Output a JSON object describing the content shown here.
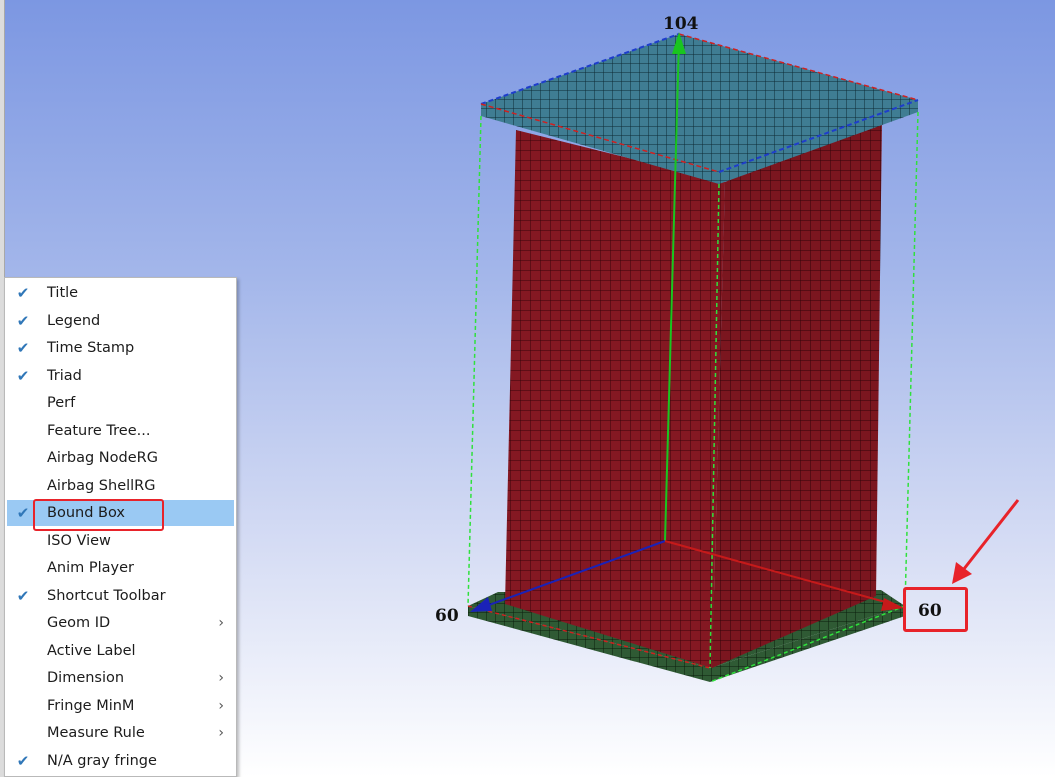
{
  "viewport": {
    "dimension_top": "104",
    "dimension_left": "60",
    "dimension_right": "60"
  },
  "menu": {
    "items": [
      {
        "label": "Title",
        "checked": true,
        "submenu": false
      },
      {
        "label": "Legend",
        "checked": true,
        "submenu": false
      },
      {
        "label": "Time Stamp",
        "checked": true,
        "submenu": false
      },
      {
        "label": "Triad",
        "checked": true,
        "submenu": false
      },
      {
        "label": "Perf",
        "checked": false,
        "submenu": false
      },
      {
        "label": "Feature Tree...",
        "checked": false,
        "submenu": false
      },
      {
        "label": "Airbag NodeRG",
        "checked": false,
        "submenu": false
      },
      {
        "label": "Airbag ShellRG",
        "checked": false,
        "submenu": false
      },
      {
        "label": "Bound Box",
        "checked": true,
        "submenu": false,
        "selected": true
      },
      {
        "label": "ISO View",
        "checked": false,
        "submenu": false
      },
      {
        "label": "Anim Player",
        "checked": false,
        "submenu": false
      },
      {
        "label": "Shortcut Toolbar",
        "checked": true,
        "submenu": false
      },
      {
        "label": "Geom ID",
        "checked": false,
        "submenu": true
      },
      {
        "label": "Active Label",
        "checked": false,
        "submenu": false
      },
      {
        "label": "Dimension",
        "checked": false,
        "submenu": true
      },
      {
        "label": "Fringe MinM",
        "checked": false,
        "submenu": true
      },
      {
        "label": "Measure Rule",
        "checked": false,
        "submenu": true
      },
      {
        "label": "N/A gray fringe",
        "checked": true,
        "submenu": false
      }
    ]
  },
  "icons": {
    "check": "checkmark-icon",
    "submenu": "chevron-right-icon",
    "annotation": "red-arrow-annotation"
  },
  "colors": {
    "mesh_red": "#8c1a24",
    "plate_blue": "#3f7d93",
    "plate_green": "#2f5a34",
    "bbox_green": "#2fe13c",
    "annotation_red": "#e8232a",
    "menu_selected": "#9ac9f3"
  }
}
